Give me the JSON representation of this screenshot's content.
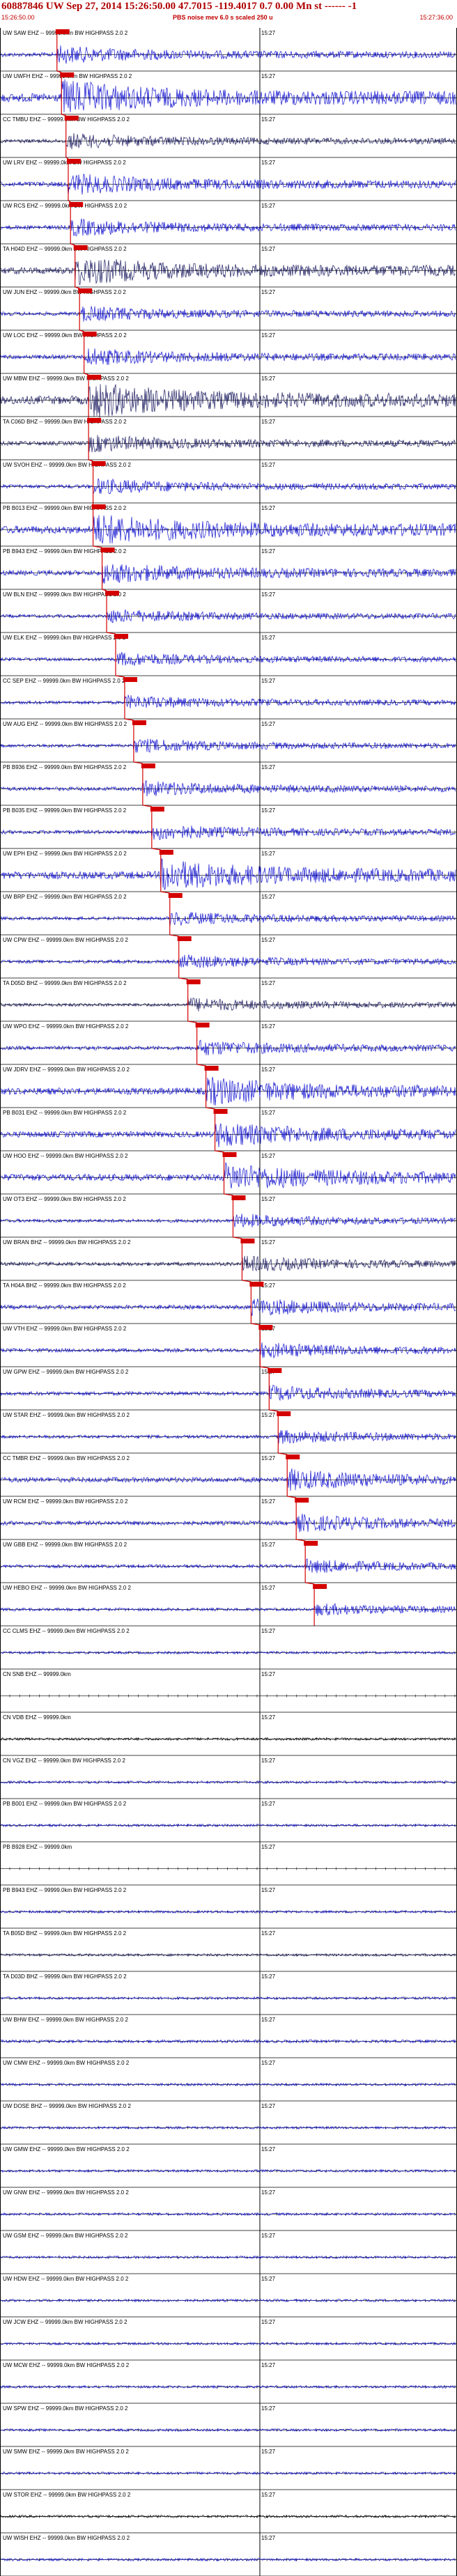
{
  "header": {
    "title": "60887846 UW Sep 27, 2014 15:26:50.00   47.7015 -119.4017  0.7 0.00 Mn st ------ -1",
    "start_time": "15:26:50.00",
    "scale_note": "PBS noise mev 6.0 s scaled 250 u",
    "end_time": "15:27:36.00"
  },
  "chart_data": {
    "type": "seismogram",
    "time_start": "15:26:50.00",
    "time_end": "15:27:36.00",
    "minute_mark": "15:27",
    "traces": [
      {
        "label": "UW SAW EHZ -- 99999.0km BW  HIGHPASS  2.0  2",
        "pick": 0.12,
        "amp": 0.5,
        "color": "#1010d0"
      },
      {
        "label": "UW UWFH EHZ -- 99999.0km BW  HIGHPASS  2.0  2",
        "pick": 0.13,
        "amp": 1.0,
        "color": "#1010d0"
      },
      {
        "label": "CC TMBU EHZ -- 99999.0km BW  HIGHPASS  2.0  2",
        "pick": 0.14,
        "amp": 0.45,
        "color": "#1a1a60"
      },
      {
        "label": "UW LRV EHZ -- 99999.0km BW  HIGHPASS  2.0  2",
        "pick": 0.145,
        "amp": 0.6,
        "color": "#1010d0"
      },
      {
        "label": "UW RCS EHZ -- 99999.0km BW  HIGHPASS  2.0  2",
        "pick": 0.15,
        "amp": 0.5,
        "color": "#1010d0"
      },
      {
        "label": "TA H04D EHZ -- 99999.0km BW  HIGHPASS  2.0  2",
        "pick": 0.16,
        "amp": 0.8,
        "color": "#1a1a60"
      },
      {
        "label": "UW JUN EHZ -- 99999.0km BW  HIGHPASS  2.0  2",
        "pick": 0.17,
        "amp": 0.45,
        "color": "#1010d0"
      },
      {
        "label": "UW LOC EHZ -- 99999.0km BW  HIGHPASS  2.0  2",
        "pick": 0.18,
        "amp": 0.5,
        "color": "#1010d0"
      },
      {
        "label": "UW MBW EHZ -- 99999.0km BW  HIGHPASS  2.0  2",
        "pick": 0.19,
        "amp": 1.0,
        "color": "#1a1a60"
      },
      {
        "label": "TA C06D BHZ -- 99999.0km BW  HIGHPASS  2.0  2",
        "pick": 0.19,
        "amp": 0.5,
        "color": "#1a1a60"
      },
      {
        "label": "UW SVOH EHZ -- 99999.0km BW  HIGHPASS  2.0  2",
        "pick": 0.2,
        "amp": 0.45,
        "color": "#1010d0"
      },
      {
        "label": "PB B013 EHZ -- 99999.0km BW  HIGHPASS  2.0  2",
        "pick": 0.2,
        "amp": 0.9,
        "color": "#1010d0"
      },
      {
        "label": "PB B943 EHZ -- 99999.0km BW  HIGHPASS  2.0  2",
        "pick": 0.22,
        "amp": 0.6,
        "color": "#1010d0"
      },
      {
        "label": "UW BLN EHZ -- 99999.0km BW  HIGHPASS  2.0  2",
        "pick": 0.23,
        "amp": 0.4,
        "color": "#1010d0"
      },
      {
        "label": "UW ELK EHZ -- 99999.0km BW  HIGHPASS  2.0  2",
        "pick": 0.25,
        "amp": 0.4,
        "color": "#1010d0"
      },
      {
        "label": "CC SEP EHZ -- 99999.0km BW  HIGHPASS  2.0  2",
        "pick": 0.27,
        "amp": 0.4,
        "color": "#1010d0"
      },
      {
        "label": "UW AUG EHZ -- 99999.0km BW  HIGHPASS  2.0  2",
        "pick": 0.29,
        "amp": 0.4,
        "color": "#1010d0"
      },
      {
        "label": "PB B936 EHZ -- 99999.0km BW  HIGHPASS  2.0  2",
        "pick": 0.31,
        "amp": 0.45,
        "color": "#1010d0"
      },
      {
        "label": "PB B035 EHZ -- 99999.0km BW  HIGHPASS  2.0  2",
        "pick": 0.33,
        "amp": 0.45,
        "color": "#1010d0"
      },
      {
        "label": "UW EPH EHZ -- 99999.0km BW  HIGHPASS  2.0  2",
        "pick": 0.35,
        "amp": 0.9,
        "color": "#1010d0"
      },
      {
        "label": "UW BRP EHZ -- 99999.0km BW  HIGHPASS  2.0  2",
        "pick": 0.37,
        "amp": 0.4,
        "color": "#1010d0"
      },
      {
        "label": "UW CPW EHZ -- 99999.0km BW  HIGHPASS  2.0  2",
        "pick": 0.39,
        "amp": 0.4,
        "color": "#1010d0"
      },
      {
        "label": "TA D05D BHZ -- 99999.0km BW  HIGHPASS  2.0  2",
        "pick": 0.41,
        "amp": 0.4,
        "color": "#1a1a60"
      },
      {
        "label": "UW WPO EHZ -- 99999.0km BW  HIGHPASS  2.0  2",
        "pick": 0.43,
        "amp": 0.45,
        "color": "#1010d0"
      },
      {
        "label": "UW JDRV EHZ -- 99999.0km BW  HIGHPASS  2.0  2",
        "pick": 0.45,
        "amp": 0.8,
        "color": "#1010d0"
      },
      {
        "label": "PB B031 EHZ -- 99999.0km BW  HIGHPASS  2.0  2",
        "pick": 0.47,
        "amp": 0.7,
        "color": "#1010d0"
      },
      {
        "label": "UW HOO EHZ -- 99999.0km BW  HIGHPASS  2.0  2",
        "pick": 0.49,
        "amp": 0.8,
        "color": "#1010d0"
      },
      {
        "label": "UW OT3 EHZ -- 99999.0km BW  HIGHPASS  2.0  2",
        "pick": 0.51,
        "amp": 0.4,
        "color": "#1010d0"
      },
      {
        "label": "UW BRAN BHZ -- 99999.0km BW  HIGHPASS  2.0  2",
        "pick": 0.53,
        "amp": 0.45,
        "color": "#1a1a60"
      },
      {
        "label": "TA H04A BHZ -- 99999.0km BW  HIGHPASS  2.0  2",
        "pick": 0.55,
        "amp": 0.5,
        "color": "#1010d0"
      },
      {
        "label": "UW VTH EHZ -- 99999.0km BW  HIGHPASS  2.0  2",
        "pick": 0.57,
        "amp": 0.45,
        "color": "#1010d0"
      },
      {
        "label": "UW GPW EHZ -- 99999.0km BW  HIGHPASS  2.0  2",
        "pick": 0.59,
        "amp": 0.45,
        "color": "#1010d0"
      },
      {
        "label": "UW STAR EHZ -- 99999.0km BW  HIGHPASS  2.0  2",
        "pick": 0.61,
        "amp": 0.4,
        "color": "#1010d0"
      },
      {
        "label": "CC TMBR EHZ -- 99999.0km BW  HIGHPASS  2.0  2",
        "pick": 0.63,
        "amp": 0.6,
        "color": "#1010d0"
      },
      {
        "label": "UW RCM EHZ -- 99999.0km BW  HIGHPASS  2.0  2",
        "pick": 0.65,
        "amp": 0.5,
        "color": "#1010d0"
      },
      {
        "label": "UW GBB EHZ -- 99999.0km BW  HIGHPASS  2.0  2",
        "pick": 0.67,
        "amp": 0.4,
        "color": "#1010d0"
      },
      {
        "label": "UW HEBO EHZ -- 99999.0km BW  HIGHPASS  2.0  2",
        "pick": 0.69,
        "amp": 0.35,
        "color": "#1010d0"
      },
      {
        "label": "CC CLMS EHZ -- 99999.0km BW  HIGHPASS  2.0  2",
        "pick": null,
        "amp": 0.3,
        "color": "#1010d0"
      },
      {
        "label": "CN SNB EHZ -- 99999.0km",
        "pick": null,
        "amp": 0.0,
        "color": "#1010d0"
      },
      {
        "label": "CN VDB EHZ -- 99999.0km",
        "pick": null,
        "amp": 0.3,
        "color": "#000000"
      },
      {
        "label": "CN VGZ EHZ -- 99999.0km BW  HIGHPASS  2.0  2",
        "pick": null,
        "amp": 0.3,
        "color": "#1010d0"
      },
      {
        "label": "PB B001 EHZ -- 99999.0km BW  HIGHPASS  2.0  2",
        "pick": null,
        "amp": 0.3,
        "color": "#1010d0"
      },
      {
        "label": "PB B928 EHZ -- 99999.0km",
        "pick": null,
        "amp": 0.0,
        "color": "#1010d0"
      },
      {
        "label": "PB B943 EHZ -- 99999.0km BW  HIGHPASS  2.0  2",
        "pick": null,
        "amp": 0.3,
        "color": "#1010d0"
      },
      {
        "label": "TA B05D BHZ -- 99999.0km BW  HIGHPASS  2.0  2",
        "pick": null,
        "amp": 0.3,
        "color": "#1a1a60"
      },
      {
        "label": "TA D03D BHZ -- 99999.0km BW  HIGHPASS  2.0  2",
        "pick": null,
        "amp": 0.3,
        "color": "#1010d0"
      },
      {
        "label": "UW BHW EHZ -- 99999.0km BW  HIGHPASS  2.0  2",
        "pick": null,
        "amp": 0.35,
        "color": "#1010d0"
      },
      {
        "label": "UW CMW EHZ -- 99999.0km BW  HIGHPASS  2.0  2",
        "pick": null,
        "amp": 0.3,
        "color": "#1010d0"
      },
      {
        "label": "UW DOSE BHZ -- 99999.0km BW  HIGHPASS  2.0  2",
        "pick": null,
        "amp": 0.3,
        "color": "#1010d0"
      },
      {
        "label": "UW GMW EHZ -- 99999.0km BW  HIGHPASS  2.0  2",
        "pick": null,
        "amp": 0.3,
        "color": "#1010d0"
      },
      {
        "label": "UW GNW EHZ -- 99999.0km BW  HIGHPASS  2.0  2",
        "pick": null,
        "amp": 0.3,
        "color": "#1010d0"
      },
      {
        "label": "UW GSM EHZ -- 99999.0km BW  HIGHPASS  2.0  2",
        "pick": null,
        "amp": 0.3,
        "color": "#1010d0"
      },
      {
        "label": "UW HDW EHZ -- 99999.0km BW  HIGHPASS  2.0  2",
        "pick": null,
        "amp": 0.3,
        "color": "#1010d0"
      },
      {
        "label": "UW JCW EHZ -- 99999.0km BW  HIGHPASS  2.0  2",
        "pick": null,
        "amp": 0.3,
        "color": "#1010d0"
      },
      {
        "label": "UW MCW EHZ -- 99999.0km BW  HIGHPASS  2.0  2",
        "pick": null,
        "amp": 0.3,
        "color": "#1010d0"
      },
      {
        "label": "UW SPW EHZ -- 99999.0km BW  HIGHPASS  2.0  2",
        "pick": null,
        "amp": 0.3,
        "color": "#1010d0"
      },
      {
        "label": "UW SMW EHZ -- 99999.0km BW  HIGHPASS  2.0  2",
        "pick": null,
        "amp": 0.3,
        "color": "#1010d0"
      },
      {
        "label": "UW STOR EHZ -- 99999.0km BW  HIGHPASS  2.0  2",
        "pick": null,
        "amp": 0.3,
        "color": "#000000"
      },
      {
        "label": "UW WISH EHZ -- 99999.0km BW  HIGHPASS  2.0  2",
        "pick": null,
        "amp": 0.3,
        "color": "#1010d0"
      }
    ]
  },
  "colors": {
    "pick_marker": "#d40000",
    "header_text": "#b00000",
    "trace_blue": "#1010d0",
    "trace_dark": "#1a1a60",
    "baseline": "#000000"
  }
}
